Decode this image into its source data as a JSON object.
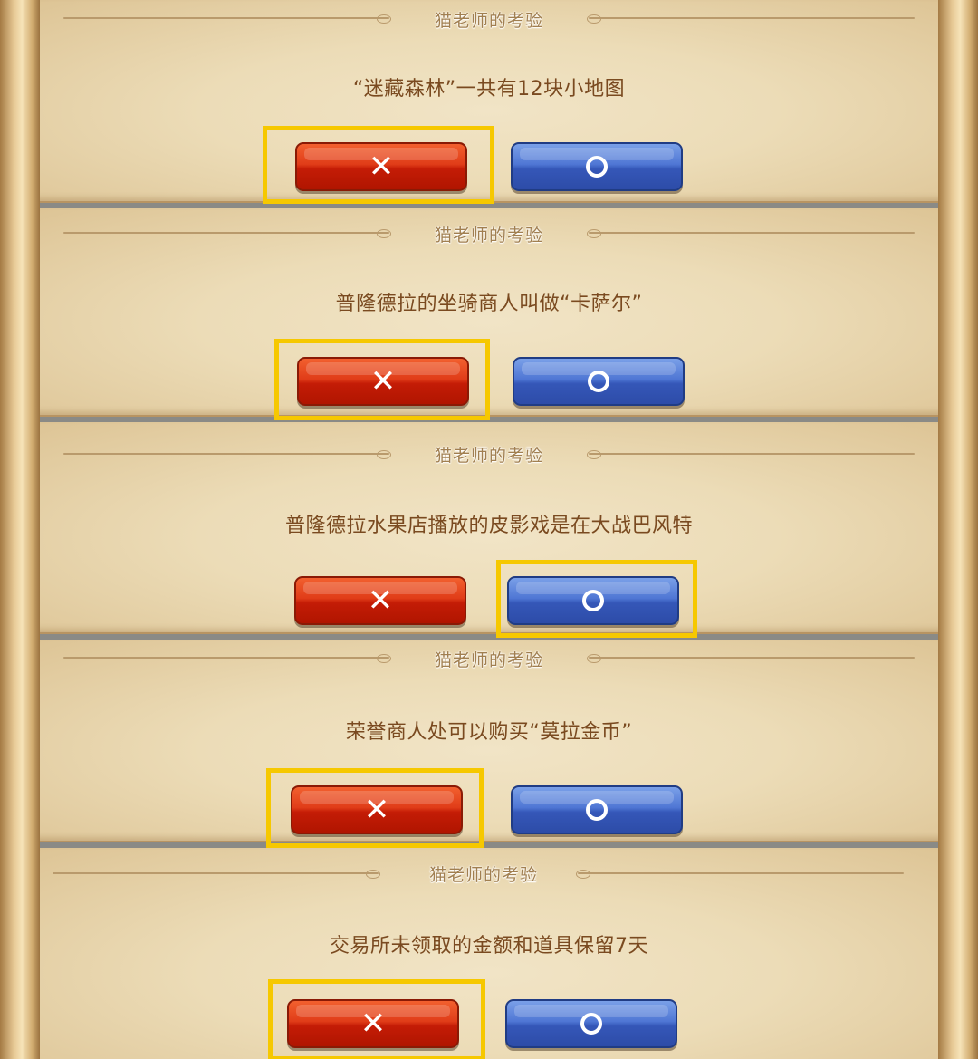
{
  "panels": [
    {
      "title": "猫老师的考验",
      "question": "“迷藏森林”一共有12块小地图",
      "false_icon": "✕",
      "true_icon": "circle-icon",
      "highlighted": "false"
    },
    {
      "title": "猫老师的考验",
      "question": "普隆德拉的坐骑商人叫做“卡萨尔”",
      "false_icon": "✕",
      "true_icon": "circle-icon",
      "highlighted": "false"
    },
    {
      "title": "猫老师的考验",
      "question": "普隆德拉水果店播放的皮影戏是在大战巴风特",
      "false_icon": "✕",
      "true_icon": "circle-icon",
      "highlighted": "true"
    },
    {
      "title": "猫老师的考验",
      "question": "荣誉商人处可以购买“莫拉金币”",
      "false_icon": "✕",
      "true_icon": "circle-icon",
      "highlighted": "false"
    },
    {
      "title": "猫老师的考验",
      "question": "交易所未领取的金额和道具保留7天",
      "false_icon": "✕",
      "true_icon": "circle-icon",
      "highlighted": "false"
    }
  ],
  "colors": {
    "highlight": "#f6c800",
    "false_button": "#d82a0c",
    "true_button": "#4569c8",
    "question_text": "#7a4a20"
  }
}
